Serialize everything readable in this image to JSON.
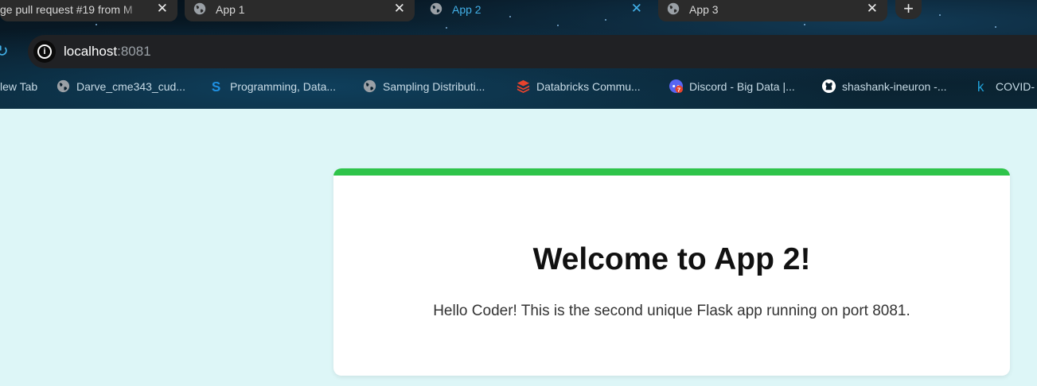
{
  "tabs": [
    {
      "title": "ge pull request #19 from M",
      "close": "✕"
    },
    {
      "title": "App 1",
      "close": "✕"
    },
    {
      "title": "App 2",
      "close": "✕"
    },
    {
      "title": "App 3",
      "close": "✕"
    }
  ],
  "new_tab": "+",
  "address_bar": {
    "host": "localhost",
    "port": ":8081"
  },
  "bookmarks": [
    {
      "label": "lew Tab",
      "icon": "none"
    },
    {
      "label": "Darve_cme343_cud...",
      "icon": "globe-icon"
    },
    {
      "label": "Programming, Data...",
      "icon": "s-logo-icon"
    },
    {
      "label": "Sampling Distributi...",
      "icon": "globe-icon"
    },
    {
      "label": "Databricks Commu...",
      "icon": "databricks-icon"
    },
    {
      "label": "Discord - Big Data |...",
      "icon": "discord-icon"
    },
    {
      "label": "shashank-ineuron -...",
      "icon": "github-icon"
    },
    {
      "label": "COVID-",
      "icon": "k-logo-icon"
    }
  ],
  "page": {
    "heading": "Welcome to App 2!",
    "message": "Hello Coder! This is the second unique Flask app running on port 8081."
  },
  "colors": {
    "background": "#ddf6f7",
    "accent_bar": "#2ec44a",
    "active_tab_text": "#42b0e8"
  }
}
